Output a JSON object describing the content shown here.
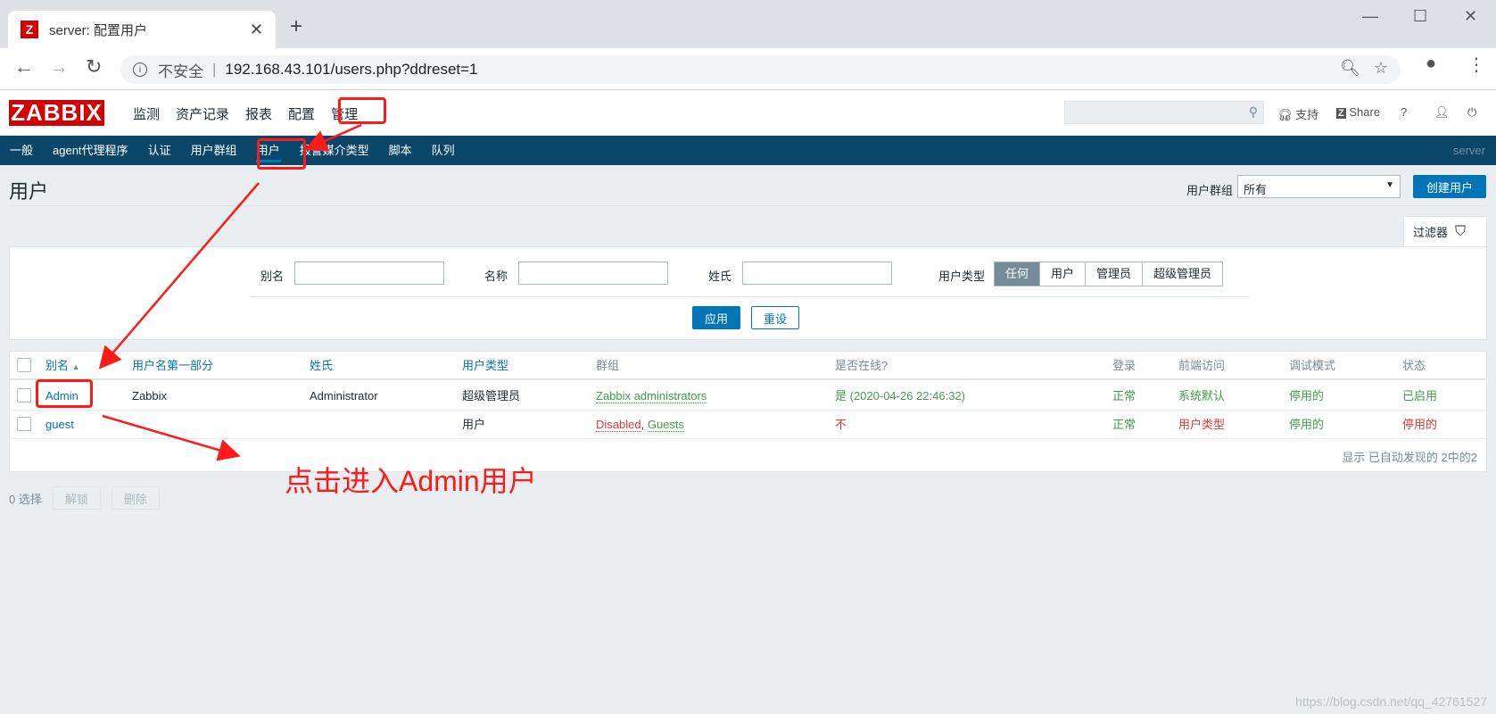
{
  "browser": {
    "tab_title": "server: 配置用户",
    "favicon_letter": "Z",
    "insecure_label": "不安全",
    "url": "192.168.43.101/users.php?ddreset=1"
  },
  "header": {
    "logo": "ZABBIX",
    "menu": [
      "监测",
      "资产记录",
      "报表",
      "配置",
      "管理"
    ],
    "support": "支持",
    "share": "Share",
    "help": "?"
  },
  "subnav": {
    "items": [
      "一般",
      "agent代理程序",
      "认证",
      "用户群组",
      "用户",
      "报警媒介类型",
      "脚本",
      "队列"
    ],
    "active": "用户",
    "server": "server"
  },
  "page": {
    "title": "用户",
    "group_label": "用户群组",
    "group_value": "所有",
    "create_button": "创建用户"
  },
  "filter": {
    "tab_label": "过滤器",
    "alias_label": "别名",
    "name_label": "名称",
    "surname_label": "姓氏",
    "type_label": "用户类型",
    "type_options": [
      "任何",
      "用户",
      "管理员",
      "超级管理员"
    ],
    "type_selected": "任何",
    "apply": "应用",
    "reset": "重设"
  },
  "table": {
    "headers": {
      "alias": "别名",
      "name": "用户名第一部分",
      "surname": "姓氏",
      "type": "用户类型",
      "groups": "群组",
      "online": "是否在线?",
      "login": "登录",
      "frontend": "前端访问",
      "debug": "调试模式",
      "status": "状态"
    },
    "rows": [
      {
        "alias": "Admin",
        "name": "Zabbix",
        "surname": "Administrator",
        "type": "超级管理员",
        "groups": "Zabbix administrators",
        "online": "是 (2020-04-26 22:46:32)",
        "login": "正常",
        "frontend": "系统默认",
        "debug": "停用的",
        "status": "已启用"
      },
      {
        "alias": "guest",
        "name": "",
        "surname": "",
        "type": "用户",
        "groups_1": "Disabled",
        "groups_sep": ",",
        "groups_2": "Guests",
        "online": "不",
        "login": "正常",
        "frontend": "用户类型",
        "debug": "停用的",
        "status": "停用的"
      }
    ],
    "footer": "显示 已自动发现的 2中的2"
  },
  "bulk": {
    "selected": "0 选择",
    "unlock": "解锁",
    "delete": "删除"
  },
  "annotation": {
    "text": "点击进入Admin用户",
    "color": "#ff1a1a"
  },
  "watermark": "https://blog.csdn.net/qq_42761527"
}
